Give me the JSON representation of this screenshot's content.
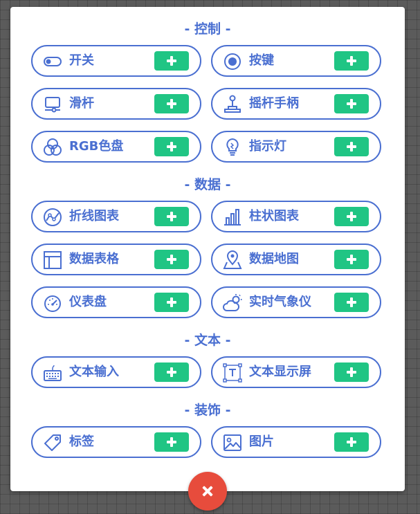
{
  "sections": [
    {
      "title": "- 控制 -",
      "items": [
        {
          "label": "开关",
          "icon": "toggle-switch-icon"
        },
        {
          "label": "按键",
          "icon": "radio-button-icon"
        },
        {
          "label": "滑杆",
          "icon": "slider-icon"
        },
        {
          "label": "摇杆手柄",
          "icon": "joystick-icon"
        },
        {
          "label": "RGB色盘",
          "icon": "rgb-circles-icon"
        },
        {
          "label": "指示灯",
          "icon": "light-bulb-icon"
        }
      ]
    },
    {
      "title": "- 数据 -",
      "items": [
        {
          "label": "折线图表",
          "icon": "line-chart-icon"
        },
        {
          "label": "柱状图表",
          "icon": "bar-chart-icon"
        },
        {
          "label": "数据表格",
          "icon": "table-icon"
        },
        {
          "label": "数据地图",
          "icon": "map-pin-icon"
        },
        {
          "label": "仪表盘",
          "icon": "gauge-icon"
        },
        {
          "label": "实时气象仪",
          "icon": "weather-icon"
        }
      ]
    },
    {
      "title": "- 文本 -",
      "items": [
        {
          "label": "文本输入",
          "icon": "keyboard-icon"
        },
        {
          "label": "文本显示屏",
          "icon": "text-frame-icon"
        }
      ]
    },
    {
      "title": "- 装饰 -",
      "items": [
        {
          "label": "标签",
          "icon": "tag-icon"
        },
        {
          "label": "图片",
          "icon": "image-icon"
        }
      ]
    }
  ],
  "colors": {
    "accent": "#4a6fd1",
    "add_button": "#20c584",
    "close_button": "#e74c3c",
    "panel": "#ffffff",
    "background": "#5b5b5b"
  },
  "add_button_icon": "plus-icon",
  "close_button_icon": "close-icon"
}
